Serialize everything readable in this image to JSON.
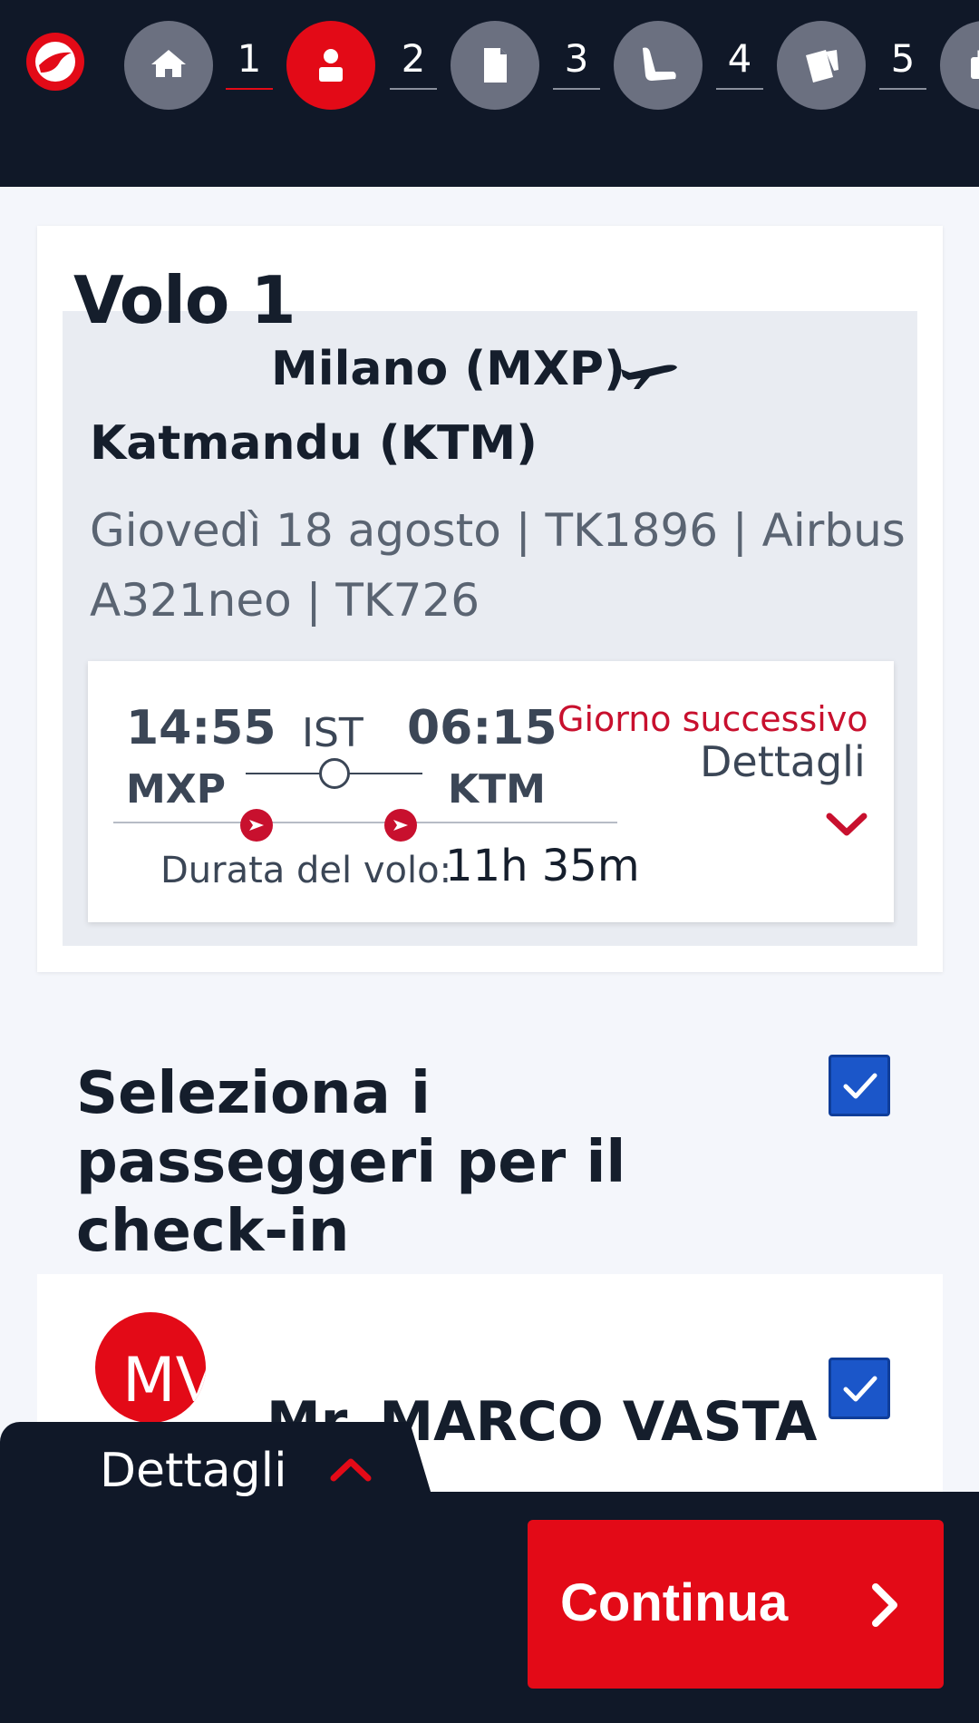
{
  "header": {
    "logo_icon": "turkish-airlines-logo-icon",
    "steps": [
      {
        "number": "1",
        "icon": "home-icon",
        "active": false
      },
      {
        "number": "2",
        "icon": "passenger-icon",
        "active": true
      },
      {
        "number": "3",
        "icon": "document-icon",
        "active": false
      },
      {
        "number": "4",
        "icon": "seat-icon",
        "active": false
      },
      {
        "number": "5",
        "icon": "boarding-pass-icon",
        "active": false
      }
    ],
    "colors": {
      "background": "#101828",
      "active": "#e30a17",
      "inactive": "#6b7080"
    }
  },
  "flight": {
    "title": "Volo 1",
    "origin": "Milano (MXP)",
    "destination": "Katmandu (KTM)",
    "info": "Giovedì 18 agosto | TK1896 | Airbus A321neo | TK726",
    "segment": {
      "departure_time": "14:55",
      "departure_code": "MXP",
      "via_code": "IST",
      "arrival_time": "06:15",
      "arrival_code": "KTM",
      "next_day_label": "Giorno successivo",
      "details_label": "Dettagli",
      "duration_label": "Durata del volo:",
      "duration_value": "11h 35m"
    }
  },
  "passengers": {
    "heading": "Seleziona i passeggeri per il check-in",
    "select_all_checked": true,
    "list": [
      {
        "initials": "MV",
        "name": "Mr. MARCO VASTA",
        "checked": true
      }
    ]
  },
  "footer": {
    "details_label": "Dettagli",
    "continue_label": "Continua"
  }
}
